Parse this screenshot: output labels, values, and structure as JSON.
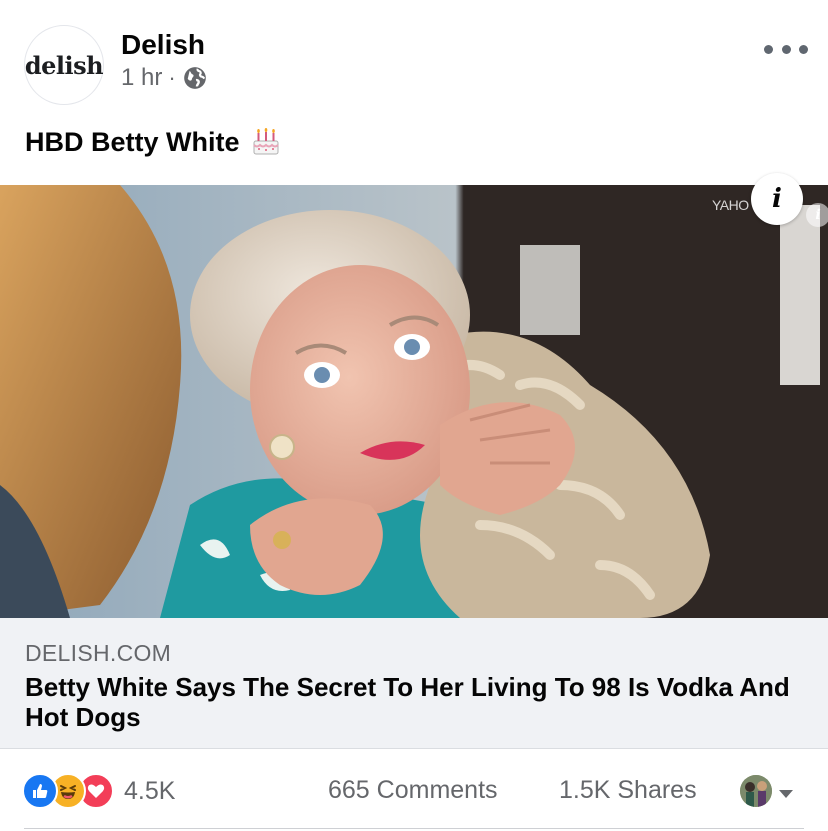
{
  "header": {
    "avatar_logo": "delish",
    "page_name": "Delish",
    "time": "1 hr",
    "separator": "·",
    "audience_icon": "globe-icon",
    "more_icon": "more-options-icon"
  },
  "post": {
    "caption": "HBD Betty White",
    "caption_emoji": "birthday-cake-icon"
  },
  "media": {
    "watermark": "YAHO",
    "info_label": "i"
  },
  "link_preview": {
    "domain": "DELISH.COM",
    "title": "Betty White Says The Secret To Her Living To 98 Is Vodka And Hot Dogs"
  },
  "stats": {
    "reaction_icons": [
      "like-icon",
      "haha-icon",
      "love-icon"
    ],
    "reactions_count": "4.5K",
    "comments": "665 Comments",
    "shares": "1.5K Shares"
  },
  "colors": {
    "brand_blue": "#1877f2",
    "haha_yellow": "#f7b125",
    "love_red": "#f33e58",
    "secondary_text": "#65676b",
    "preview_bg": "#f0f2f5"
  }
}
